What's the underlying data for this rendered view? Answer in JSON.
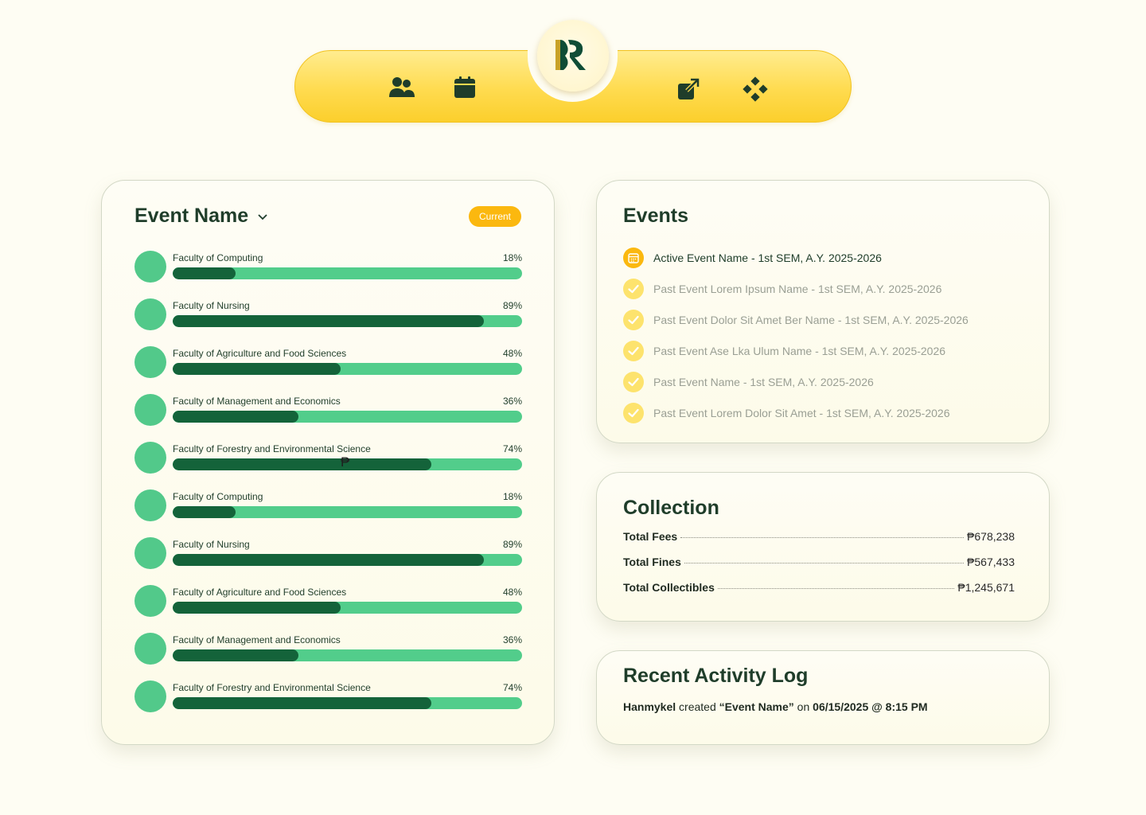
{
  "nav": {
    "logo_alt": "R",
    "icons": [
      "users-icon",
      "calendar-icon",
      "external-link-icon",
      "diamond-grid-icon"
    ]
  },
  "event_card": {
    "title": "Event Name",
    "badge": "Current",
    "faculties": [
      {
        "name": "Faculty of Computing",
        "percent_label": "18%",
        "percent": 18
      },
      {
        "name": "Faculty of Nursing",
        "percent_label": "89%",
        "percent": 89
      },
      {
        "name": "Faculty of Agriculture and Food Sciences",
        "percent_label": "48%",
        "percent": 48
      },
      {
        "name": "Faculty of Management and Economics",
        "percent_label": "36%",
        "percent": 36
      },
      {
        "name": "Faculty of Forestry and Environmental Science",
        "percent_label": "74%",
        "percent": 74
      },
      {
        "name": "Faculty of Computing",
        "percent_label": "18%",
        "percent": 18
      },
      {
        "name": "Faculty of Nursing",
        "percent_label": "89%",
        "percent": 89
      },
      {
        "name": "Faculty of Agriculture and Food Sciences",
        "percent_label": "48%",
        "percent": 48
      },
      {
        "name": "Faculty of Management and Economics",
        "percent_label": "36%",
        "percent": 36
      },
      {
        "name": "Faculty of Forestry and Environmental Science",
        "percent_label": "74%",
        "percent": 74
      }
    ],
    "stray_glyph": "₱"
  },
  "events": {
    "title": "Events",
    "active": "Active Event Name - 1st SEM, A.Y. 2025-2026",
    "past": [
      "Past Event Lorem Ipsum Name - 1st SEM, A.Y. 2025-2026",
      "Past Event Dolor Sit Amet Ber Name - 1st SEM, A.Y. 2025-2026",
      "Past Event Ase Lka Ulum  Name - 1st SEM, A.Y. 2025-2026",
      "Past Event Name - 1st SEM, A.Y. 2025-2026",
      "Past Event Lorem Dolor Sit Amet - 1st SEM, A.Y. 2025-2026"
    ]
  },
  "collection": {
    "title": "Collection",
    "rows": [
      {
        "label": "Total Fees",
        "value": "₱678,238"
      },
      {
        "label": "Total Fines",
        "value": "₱567,433"
      },
      {
        "label": "Total Collectibles",
        "value": "₱1,245,671"
      }
    ]
  },
  "activity": {
    "title": "Recent Activity Log",
    "user": "Hanmykel",
    "action": " created ",
    "target": "“Event Name”",
    "on": " on ",
    "datetime": "06/15/2025 @ 8:15 PM"
  },
  "colors": {
    "primary_dark": "#14633a",
    "primary_light": "#52cd8b",
    "accent": "#fbb80f",
    "nav_yellow": "#ffdb4f"
  }
}
